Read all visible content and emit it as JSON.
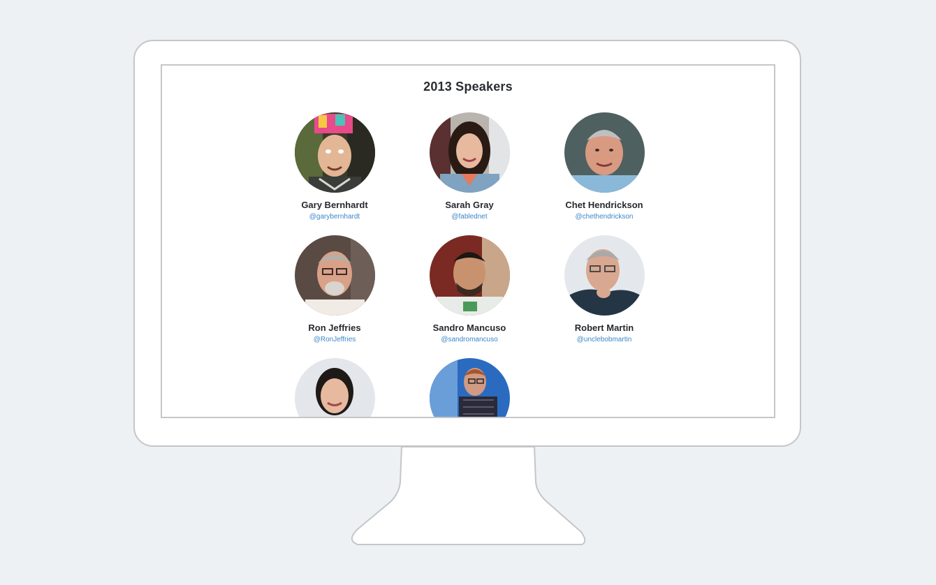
{
  "page": {
    "title": "2013 Speakers"
  },
  "speakers": [
    {
      "name": "Gary Bernhardt",
      "handle": "@garybernhardt"
    },
    {
      "name": "Sarah Gray",
      "handle": "@fablednet"
    },
    {
      "name": "Chet Hendrickson",
      "handle": "@chethendrickson"
    },
    {
      "name": "Ron Jeffries",
      "handle": "@RonJeffries"
    },
    {
      "name": "Sandro Mancuso",
      "handle": "@sandromancuso"
    },
    {
      "name": "Robert Martin",
      "handle": "@unclebobmartin"
    },
    {
      "name": "",
      "handle": ""
    },
    {
      "name": "",
      "handle": ""
    }
  ],
  "colors": {
    "background": "#eef1f4",
    "frame_border": "#c4c6c8",
    "title": "#2a2d31",
    "handle_link": "#3a86c8"
  }
}
